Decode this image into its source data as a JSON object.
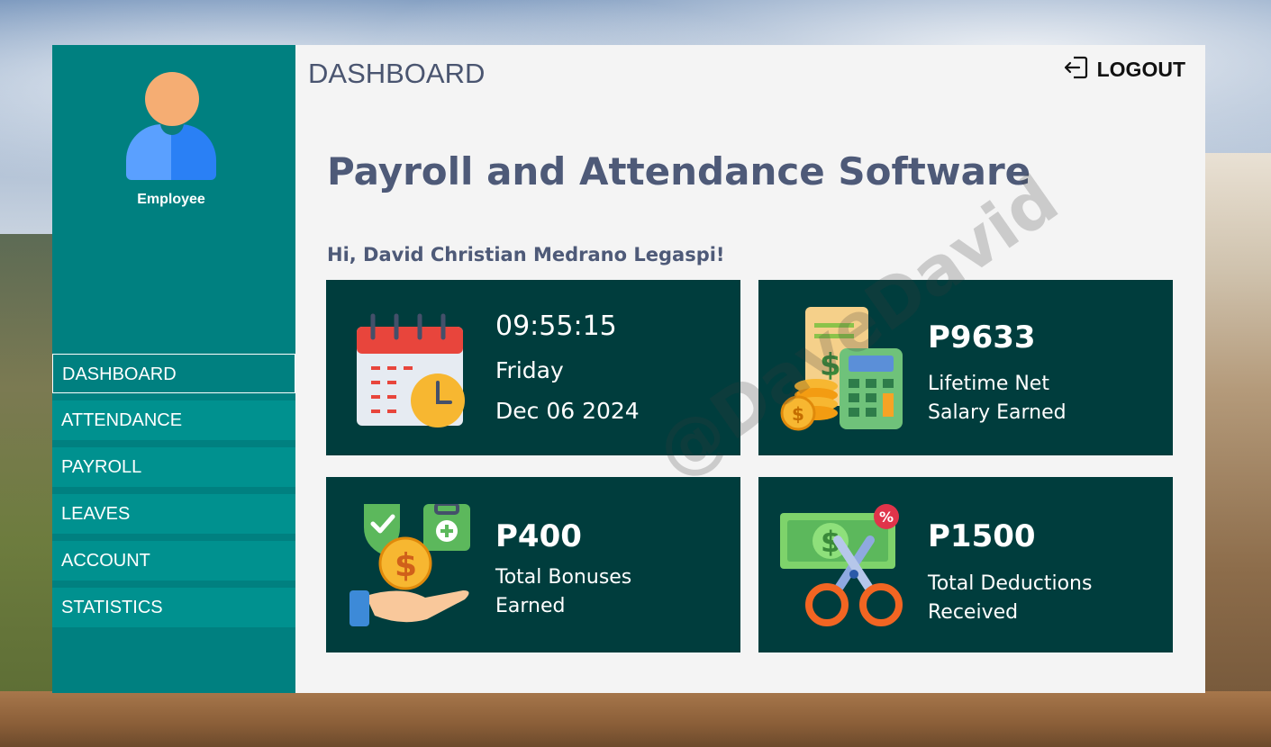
{
  "sidebar": {
    "role": "Employee",
    "items": [
      {
        "label": "DASHBOARD",
        "active": true
      },
      {
        "label": "ATTENDANCE",
        "active": false
      },
      {
        "label": "PAYROLL",
        "active": false
      },
      {
        "label": "LEAVES",
        "active": false
      },
      {
        "label": "ACCOUNT",
        "active": false
      },
      {
        "label": "STATISTICS",
        "active": false
      }
    ]
  },
  "header": {
    "title": "DASHBOARD",
    "logout_label": "LOGOUT"
  },
  "main": {
    "app_title": "Payroll and Attendance Software",
    "greeting": "Hi, David Christian Medrano Legaspi!",
    "clock": {
      "time": "09:55:15",
      "day": "Friday",
      "date": "Dec 06 2024"
    },
    "salary": {
      "value": "P9633",
      "line1": "Lifetime Net",
      "line2": "Salary Earned"
    },
    "bonuses": {
      "value": "P400",
      "line1": "Total Bonuses",
      "line2": "Earned"
    },
    "deductions": {
      "value": "P1500",
      "line1": "Total Deductions",
      "line2": "Received"
    }
  },
  "watermark": "@DaveDavid",
  "colors": {
    "sidebar": "#008080",
    "card": "#003d3d",
    "text": "#4e5a78"
  }
}
